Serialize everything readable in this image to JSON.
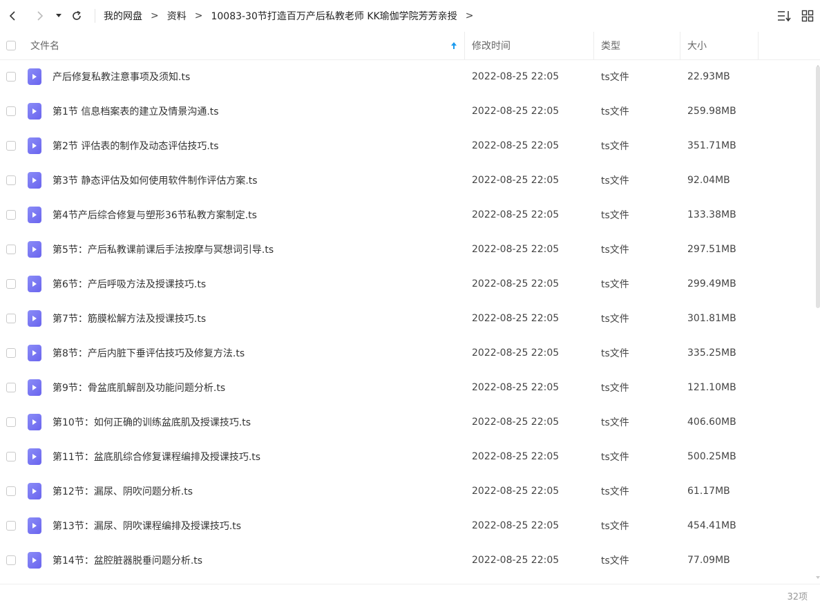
{
  "nav": {
    "back_icon": "chevron-left-icon",
    "forward_icon": "chevron-right-icon",
    "history_icon": "caret-down-icon",
    "refresh_icon": "refresh-icon",
    "sort_icon": "sort-desc-icon",
    "grid_icon": "grid-view-icon"
  },
  "breadcrumb": [
    {
      "label": "我的网盘"
    },
    {
      "label": "资料"
    },
    {
      "label": "10083-30节打造百万产后私教老师 KK瑜伽学院芳芳亲授"
    }
  ],
  "breadcrumb_separator": ">",
  "header": {
    "name": "文件名",
    "modified": "修改时间",
    "type": "类型",
    "size": "大小",
    "sort_arrow_color": "#1a9aef"
  },
  "files": [
    {
      "name": "产后修复私教注意事项及须知.ts",
      "modified": "2022-08-25 22:05",
      "type": "ts文件",
      "size": "22.93MB"
    },
    {
      "name": "第1节 信息档案表的建立及情景沟通.ts",
      "modified": "2022-08-25 22:05",
      "type": "ts文件",
      "size": "259.98MB"
    },
    {
      "name": "第2节 评估表的制作及动态评估技巧.ts",
      "modified": "2022-08-25 22:05",
      "type": "ts文件",
      "size": "351.71MB"
    },
    {
      "name": "第3节 静态评估及如何使用软件制作评估方案.ts",
      "modified": "2022-08-25 22:05",
      "type": "ts文件",
      "size": "92.04MB"
    },
    {
      "name": "第4节产后综合修复与塑形36节私教方案制定.ts",
      "modified": "2022-08-25 22:05",
      "type": "ts文件",
      "size": "133.38MB"
    },
    {
      "name": "第5节：产后私教课前课后手法按摩与冥想词引导.ts",
      "modified": "2022-08-25 22:05",
      "type": "ts文件",
      "size": "297.51MB"
    },
    {
      "name": "第6节：产后呼吸方法及授课技巧.ts",
      "modified": "2022-08-25 22:05",
      "type": "ts文件",
      "size": "299.49MB"
    },
    {
      "name": "第7节：筋膜松解方法及授课技巧.ts",
      "modified": "2022-08-25 22:05",
      "type": "ts文件",
      "size": "301.81MB"
    },
    {
      "name": "第8节：产后内脏下垂评估技巧及修复方法.ts",
      "modified": "2022-08-25 22:05",
      "type": "ts文件",
      "size": "335.25MB"
    },
    {
      "name": "第9节：骨盆底肌解剖及功能问题分析.ts",
      "modified": "2022-08-25 22:05",
      "type": "ts文件",
      "size": "121.10MB"
    },
    {
      "name": "第10节：如何正确的训练盆底肌及授课技巧.ts",
      "modified": "2022-08-25 22:05",
      "type": "ts文件",
      "size": "406.60MB"
    },
    {
      "name": "第11节：盆底肌综合修复课程编排及授课技巧.ts",
      "modified": "2022-08-25 22:05",
      "type": "ts文件",
      "size": "500.25MB"
    },
    {
      "name": "第12节：漏尿、阴吹问题分析.ts",
      "modified": "2022-08-25 22:05",
      "type": "ts文件",
      "size": "61.17MB"
    },
    {
      "name": "第13节：漏尿、阴吹课程编排及授课技巧.ts",
      "modified": "2022-08-25 22:05",
      "type": "ts文件",
      "size": "454.41MB"
    },
    {
      "name": "第14节：盆腔脏器脱垂问题分析.ts",
      "modified": "2022-08-25 22:05",
      "type": "ts文件",
      "size": "77.09MB"
    }
  ],
  "file_icon": "video-file-icon",
  "footer": {
    "count": "32项"
  }
}
